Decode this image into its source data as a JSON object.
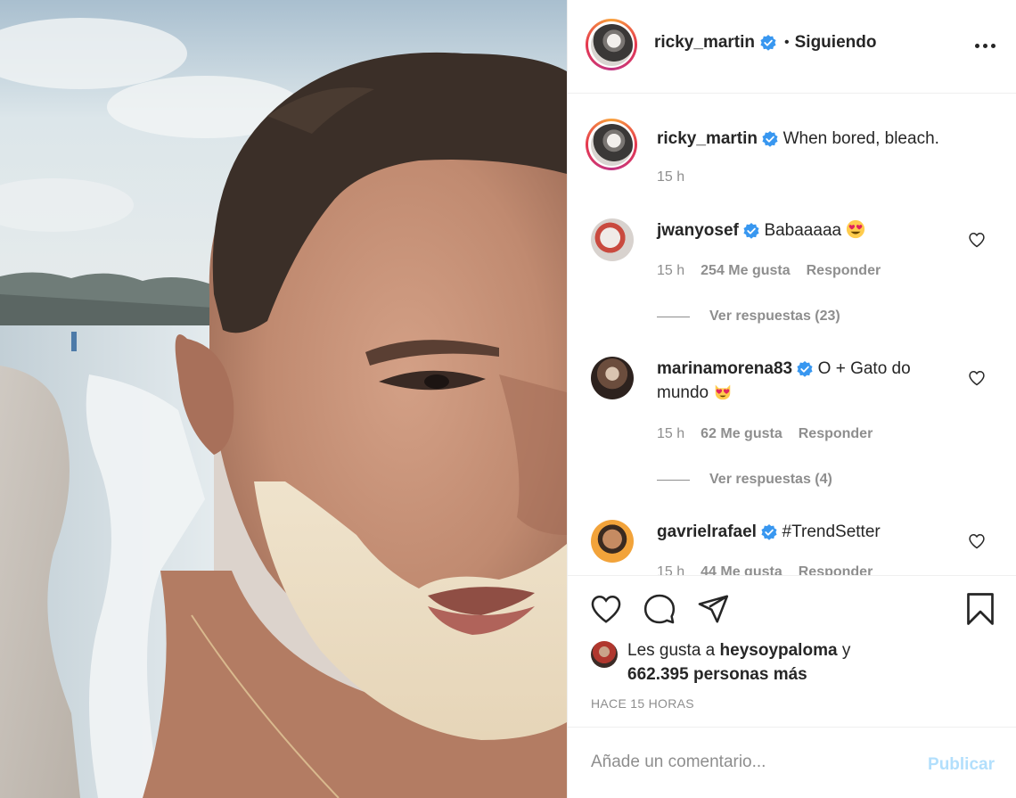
{
  "post": {
    "author": "ricky_martin",
    "follow_status": "Siguiendo",
    "dot": "•",
    "photo_alt": "photo",
    "caption": {
      "username": "ricky_martin",
      "text": "When bored, bleach.",
      "time": "15 h"
    }
  },
  "comments": [
    {
      "username": "jwanyosef",
      "text": "Babaaaaa",
      "emoji": "heart-eyes-emoji",
      "time": "15 h",
      "likes": "254 Me gusta",
      "reply": "Responder",
      "view_replies": "Ver respuestas (23)"
    },
    {
      "username": "marinamorena83",
      "text": "O + Gato do",
      "text_line2": "mundo",
      "emoji": "heart-eyes-cat-emoji",
      "time": "15 h",
      "likes": "62 Me gusta",
      "reply": "Responder",
      "view_replies": "Ver respuestas (4)"
    },
    {
      "username": "gavrielrafael",
      "text": "#TrendSetter",
      "time": "15 h",
      "likes": "44 Me gusta",
      "reply": "Responder"
    }
  ],
  "likes": {
    "prefix": "Les gusta a",
    "user": "heysoypaloma",
    "conj": "y",
    "count": "662.395 personas más"
  },
  "timestamp": "HACE 15 HORAS",
  "composer": {
    "placeholder": "Añade un comentario...",
    "publish": "Publicar"
  },
  "colors": {
    "verified": "#3897f0",
    "muted": "#8e8e8e",
    "publish_disabled": "#b2dffc",
    "hashtag": "#00376b"
  }
}
